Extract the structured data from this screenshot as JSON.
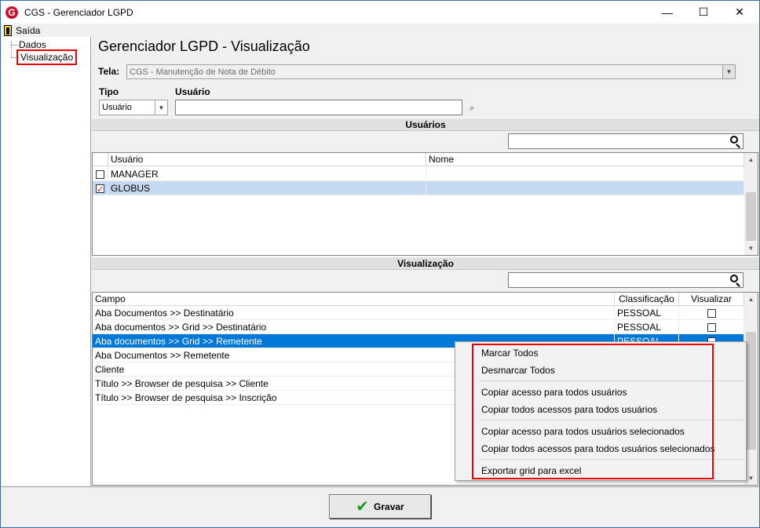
{
  "window": {
    "title": "CGS - Gerenciador LGPD",
    "minimize": "—",
    "maximize": "☐",
    "close": "✕",
    "app_icon_glyph": "G"
  },
  "menu": {
    "exit_label": "Saída"
  },
  "tree": {
    "items": [
      "Dados",
      "Visualização"
    ]
  },
  "heading": "Gerenciador LGPD - Visualização",
  "tela": {
    "label": "Tela:",
    "value": "CGS - Manutenção de Nota de Débito"
  },
  "tipo": {
    "label": "Tipo",
    "value": "Usuário"
  },
  "usuario": {
    "label": "Usuário",
    "value": ""
  },
  "users_section": {
    "title": "Usuários",
    "columns": [
      "Usuário",
      "Nome"
    ],
    "rows": [
      {
        "checked": false,
        "user": "MANAGER",
        "name": ""
      },
      {
        "checked": true,
        "user": "GLOBUS",
        "name": ""
      }
    ]
  },
  "view_section": {
    "title": "Visualização",
    "columns": [
      "Campo",
      "Classificação",
      "Visualizar"
    ],
    "rows": [
      {
        "campo": "Aba Documentos >> Destinatário",
        "class": "PESSOAL",
        "checked": false
      },
      {
        "campo": "Aba documentos >> Grid  >> Destinatário",
        "class": "PESSOAL",
        "checked": false
      },
      {
        "campo": "Aba documentos >> Grid  >> Remetente",
        "class": "PESSOAL",
        "checked": false
      },
      {
        "campo": "Aba Documentos >> Remetente",
        "class": "",
        "checked": false
      },
      {
        "campo": "Cliente",
        "class": "",
        "checked": false
      },
      {
        "campo": "Título >> Browser de pesquisa >> Cliente",
        "class": "",
        "checked": false
      },
      {
        "campo": "Título >> Browser de pesquisa >> Inscrição",
        "class": "",
        "checked": false
      }
    ]
  },
  "context_menu": {
    "items": [
      "Marcar Todos",
      "Desmarcar Todos",
      "Copiar acesso para todos usuários",
      "Copiar todos acessos para todos usuários",
      "Copiar acesso para todos usuários selecionados",
      "Copiar todos acessos para todos usuários selecionados",
      "Exportar grid para excel"
    ]
  },
  "footer": {
    "save_label": "Gravar"
  },
  "colors": {
    "accent": "#0078d7",
    "highlight_frame": "#e00000",
    "selected_row": "#c5d9f1"
  }
}
